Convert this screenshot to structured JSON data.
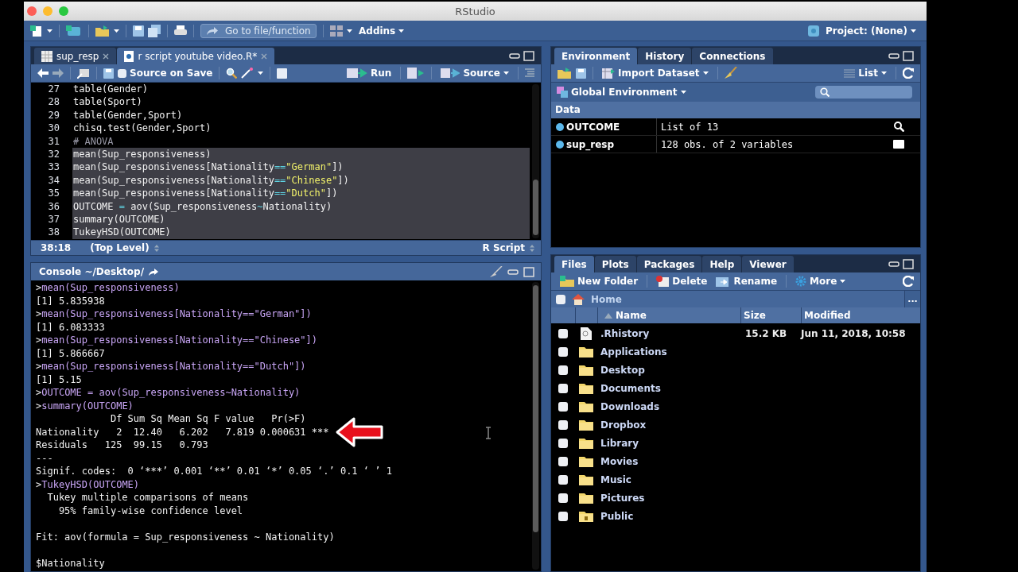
{
  "window": {
    "title": "RStudio"
  },
  "toolbar": {
    "goto": "Go to file/function",
    "addins": "Addins",
    "project": "Project: (None)"
  },
  "editor": {
    "tabs": [
      {
        "label": "sup_resp",
        "kind": "data",
        "selected": false
      },
      {
        "label": "r script youtube video.R*",
        "kind": "script",
        "selected": true
      }
    ],
    "source_on_save": {
      "label": "Source on Save",
      "checked": false
    },
    "run": "Run",
    "source": "Source",
    "lines": [
      {
        "number": "27",
        "selected": false,
        "tokens": [
          {
            "kind": "plain",
            "text": "table(Gender)"
          }
        ]
      },
      {
        "number": "28",
        "selected": false,
        "tokens": [
          {
            "kind": "plain",
            "text": "table(Sport)"
          }
        ]
      },
      {
        "number": "29",
        "selected": false,
        "tokens": [
          {
            "kind": "plain",
            "text": "table(Gender,Sport)"
          }
        ]
      },
      {
        "number": "30",
        "selected": false,
        "tokens": [
          {
            "kind": "plain",
            "text": "chisq.test(Gender,Sport)"
          }
        ]
      },
      {
        "number": "31",
        "selected": false,
        "tokens": [
          {
            "kind": "comment",
            "text": "# ANOVA"
          }
        ]
      },
      {
        "number": "32",
        "selected": true,
        "tokens": [
          {
            "kind": "plain",
            "text": "mean(Sup_responsiveness)"
          }
        ]
      },
      {
        "number": "33",
        "selected": true,
        "tokens": [
          {
            "kind": "plain",
            "text": "mean(Sup_responsiveness[Nationality"
          },
          {
            "kind": "operator",
            "text": "=="
          },
          {
            "kind": "string",
            "text": "\"German\""
          },
          {
            "kind": "plain",
            "text": "])"
          }
        ]
      },
      {
        "number": "34",
        "selected": true,
        "tokens": [
          {
            "kind": "plain",
            "text": "mean(Sup_responsiveness[Nationality"
          },
          {
            "kind": "operator",
            "text": "=="
          },
          {
            "kind": "string",
            "text": "\"Chinese\""
          },
          {
            "kind": "plain",
            "text": "])"
          }
        ]
      },
      {
        "number": "35",
        "selected": true,
        "tokens": [
          {
            "kind": "plain",
            "text": "mean(Sup_responsiveness[Nationality"
          },
          {
            "kind": "operator",
            "text": "=="
          },
          {
            "kind": "string",
            "text": "\"Dutch\""
          },
          {
            "kind": "plain",
            "text": "])"
          }
        ]
      },
      {
        "number": "36",
        "selected": true,
        "tokens": [
          {
            "kind": "plain",
            "text": "OUTCOME "
          },
          {
            "kind": "operator",
            "text": "="
          },
          {
            "kind": "plain",
            "text": " aov(Sup_responsiveness"
          },
          {
            "kind": "operator",
            "text": "~"
          },
          {
            "kind": "plain",
            "text": "Nationality)"
          }
        ]
      },
      {
        "number": "37",
        "selected": true,
        "tokens": [
          {
            "kind": "plain",
            "text": "summary(OUTCOME)"
          }
        ]
      },
      {
        "number": "38",
        "selected": true,
        "tokens": [
          {
            "kind": "plain",
            "text": "TukeyHSD(OUTCOME)"
          }
        ]
      }
    ],
    "status": {
      "position": "38:18",
      "scope": "(Top Level)",
      "filetype": "R Script"
    }
  },
  "console": {
    "title": "Console ~/Desktop/",
    "lines": [
      {
        "kind": "input",
        "prompt": ">",
        "text": "mean(Sup_responsiveness)"
      },
      {
        "kind": "output",
        "text": "[1] 5.835938"
      },
      {
        "kind": "input",
        "prompt": ">",
        "text": "mean(Sup_responsiveness[Nationality==\"German\"])"
      },
      {
        "kind": "output",
        "text": "[1] 6.083333"
      },
      {
        "kind": "input",
        "prompt": ">",
        "text": "mean(Sup_responsiveness[Nationality==\"Chinese\"])"
      },
      {
        "kind": "output",
        "text": "[1] 5.866667"
      },
      {
        "kind": "input",
        "prompt": ">",
        "text": "mean(Sup_responsiveness[Nationality==\"Dutch\"])"
      },
      {
        "kind": "output",
        "text": "[1] 5.15"
      },
      {
        "kind": "input",
        "prompt": ">",
        "text": "OUTCOME = aov(Sup_responsiveness~Nationality)"
      },
      {
        "kind": "input",
        "prompt": ">",
        "text": "summary(OUTCOME)"
      },
      {
        "kind": "output",
        "text": "             Df Sum Sq Mean Sq F value   Pr(>F)"
      },
      {
        "kind": "output",
        "text": "Nationality   2  12.40   6.202   7.819 0.000631 ***",
        "annotated": true
      },
      {
        "kind": "output",
        "text": "Residuals   125  99.15   0.793"
      },
      {
        "kind": "output",
        "text": "---"
      },
      {
        "kind": "output",
        "text": "Signif. codes:  0 ‘***’ 0.001 ‘**’ 0.01 ‘*’ 0.05 ‘.’ 0.1 ‘ ’ 1"
      },
      {
        "kind": "input",
        "prompt": ">",
        "text": "TukeyHSD(OUTCOME)"
      },
      {
        "kind": "output",
        "text": "  Tukey multiple comparisons of means"
      },
      {
        "kind": "output",
        "text": "    95% family-wise confidence level"
      },
      {
        "kind": "blank"
      },
      {
        "kind": "output",
        "text": "Fit: aov(formula = Sup_responsiveness ~ Nationality)"
      },
      {
        "kind": "blank"
      },
      {
        "kind": "output",
        "text": "$Nationality"
      }
    ]
  },
  "environment": {
    "tabs": [
      {
        "label": "Environment",
        "selected": true
      },
      {
        "label": "History",
        "selected": false
      },
      {
        "label": "Connections",
        "selected": false
      }
    ],
    "import": "Import Dataset",
    "view": "List",
    "scope": "Global Environment",
    "section": "Data",
    "rows": [
      {
        "name": "OUTCOME",
        "value": "List of 13",
        "kind": "list"
      },
      {
        "name": "sup_resp",
        "value": "128 obs. of 2 variables",
        "kind": "data"
      }
    ]
  },
  "files": {
    "tabs": [
      {
        "label": "Files",
        "selected": true
      },
      {
        "label": "Plots",
        "selected": false
      },
      {
        "label": "Packages",
        "selected": false
      },
      {
        "label": "Help",
        "selected": false
      },
      {
        "label": "Viewer",
        "selected": false
      }
    ],
    "new_folder": "New Folder",
    "delete": "Delete",
    "rename": "Rename",
    "more": "More",
    "select_all": {
      "checked": false
    },
    "path": "Home",
    "path_more": "...",
    "columns": [
      "Name",
      "Size",
      "Modified"
    ],
    "rows": [
      {
        "name": ".Rhistory",
        "kind": "file",
        "size": "15.2 KB",
        "modified": "Jun 11, 2018, 10:58",
        "checked": false
      },
      {
        "name": "Applications",
        "kind": "folder",
        "checked": false
      },
      {
        "name": "Desktop",
        "kind": "folder",
        "checked": false
      },
      {
        "name": "Documents",
        "kind": "folder",
        "checked": false
      },
      {
        "name": "Downloads",
        "kind": "folder",
        "checked": false
      },
      {
        "name": "Dropbox",
        "kind": "folder",
        "checked": false
      },
      {
        "name": "Library",
        "kind": "folder",
        "checked": false
      },
      {
        "name": "Movies",
        "kind": "folder",
        "checked": false
      },
      {
        "name": "Music",
        "kind": "folder",
        "checked": false
      },
      {
        "name": "Pictures",
        "kind": "folder",
        "checked": false
      },
      {
        "name": "Public",
        "kind": "locked-folder",
        "checked": false
      }
    ]
  }
}
